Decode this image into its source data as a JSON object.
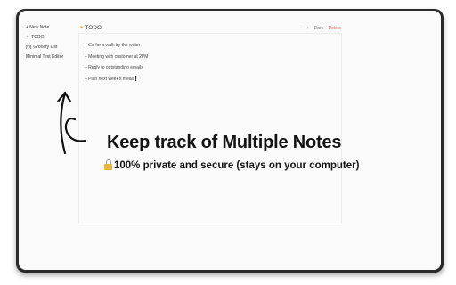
{
  "sidebar": {
    "new_note": "+ New Note",
    "items": [
      {
        "icon": "✶",
        "label": "TODO"
      },
      {
        "icon": "🍽",
        "label": "Grocery List"
      },
      {
        "icon": "",
        "label": "Minimal Text Editor"
      }
    ]
  },
  "editor": {
    "title_icon": "✶",
    "title": "TODO",
    "controls": {
      "minus": "−",
      "plus": "+",
      "dark": "Dark",
      "delete": "Delete"
    },
    "todos": [
      "– Go for a walk by the water",
      "– Meeting with customer at 2PM",
      "– Reply to outstanding emails",
      "– Plan next week's meals"
    ]
  },
  "promo": {
    "headline": "Keep track of Multiple Notes",
    "subline": "100% private and secure (stays on your computer)"
  },
  "colors": {
    "delete": "#e0524e",
    "frame": "#2b2b2b",
    "headline": "#141414"
  }
}
